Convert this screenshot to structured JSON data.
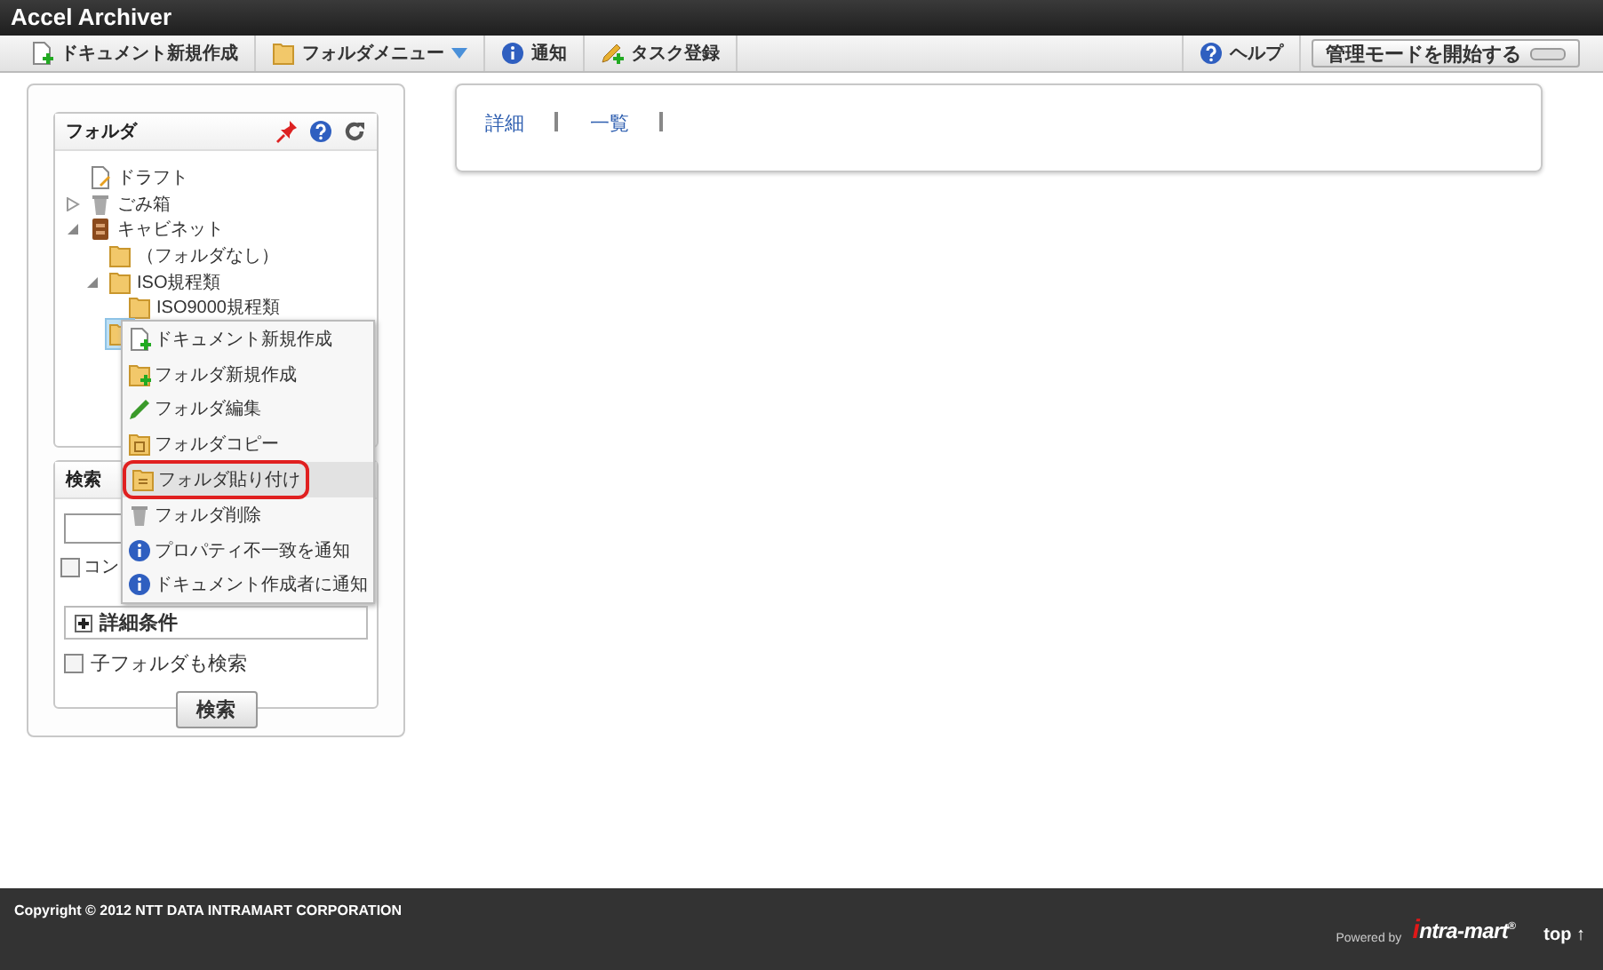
{
  "window": {
    "title": "Accel Archiver"
  },
  "toolbar": {
    "items": [
      {
        "label": "ドキュメント新規作成",
        "kind": "document",
        "dropdown": false
      },
      {
        "label": "フォルダメニュー",
        "kind": "folder",
        "dropdown": true
      },
      {
        "label": "通知",
        "kind": "info",
        "dropdown": false
      },
      {
        "label": "タスク登録",
        "kind": "task",
        "dropdown": false
      }
    ],
    "help": {
      "label": "ヘルプ",
      "kind": "help"
    },
    "admin_button": {
      "label": "管理モードを開始する",
      "on": false
    }
  },
  "folder_panel": {
    "title": "フォルダ",
    "tree": [
      {
        "label": "ドラフト",
        "kind": "draft",
        "selected": false
      },
      {
        "label": "ごみ箱",
        "kind": "trash",
        "expanded": false,
        "selected": false
      },
      {
        "label": "キャビネット",
        "kind": "cabinet",
        "expanded": true,
        "selected": false,
        "children": [
          {
            "label": "（フォルダなし）",
            "kind": "folder",
            "selected": false
          },
          {
            "label": "ISO規程類",
            "kind": "folder",
            "expanded": true,
            "selected": false,
            "children": [
              {
                "label": "ISO9000規程類",
                "kind": "folder",
                "selected": false
              }
            ]
          },
          {
            "kind": "folder",
            "selected": true
          }
        ]
      }
    ]
  },
  "search_panel": {
    "title": "検索",
    "checkboxes": [
      {
        "label": "コン",
        "checked": false
      }
    ],
    "detail": {
      "label": "詳細条件",
      "expanded": false
    },
    "subfolder": {
      "label": "子フォルダも検索",
      "checked": false
    },
    "button": "検索"
  },
  "links": [
    "詳細",
    "一覧"
  ],
  "context_menu": [
    {
      "label": "ドキュメント新規作成",
      "kind": "document",
      "selected": false
    },
    {
      "label": "フォルダ新規作成",
      "kind": "folder-new",
      "selected": false
    },
    {
      "label": "フォルダ編集",
      "kind": "pencil",
      "selected": false
    },
    {
      "label": "フォルダコピー",
      "kind": "folder-copy",
      "selected": false
    },
    {
      "label": "フォルダ貼り付け",
      "kind": "folder-paste",
      "selected": true
    },
    {
      "label": "フォルダ削除",
      "kind": "trash",
      "selected": false
    },
    {
      "label": "プロパティ不一致を通知",
      "kind": "info",
      "selected": false
    },
    {
      "label": "ドキュメント作成者に通知",
      "kind": "info",
      "selected": false
    }
  ],
  "footer": {
    "copyright": "Copyright © 2012 NTT DATA INTRAMART CORPORATION",
    "powered_by": "Powered by",
    "logo": "intra-mart$^{®}$",
    "top_link": "top ↑"
  }
}
